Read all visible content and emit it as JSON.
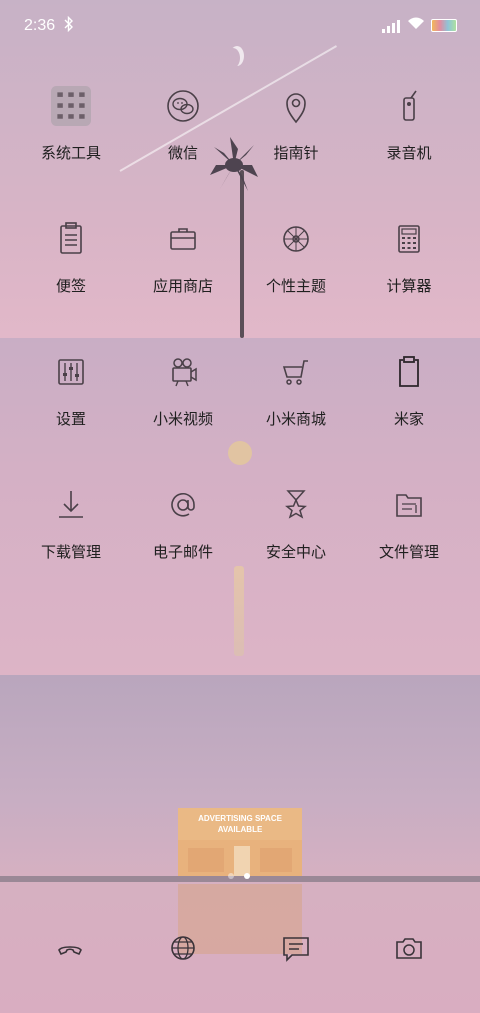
{
  "status": {
    "time": "2:36"
  },
  "apps": [
    {
      "label": "系统工具",
      "icon": "system-tools-folder-icon"
    },
    {
      "label": "微信",
      "icon": "wechat-icon"
    },
    {
      "label": "指南针",
      "icon": "compass-location-pin-icon"
    },
    {
      "label": "录音机",
      "icon": "recorder-icon"
    },
    {
      "label": "便签",
      "icon": "notes-clipboard-icon"
    },
    {
      "label": "应用商店",
      "icon": "app-store-bag-icon"
    },
    {
      "label": "个性主题",
      "icon": "themes-flower-icon"
    },
    {
      "label": "计算器",
      "icon": "calculator-icon"
    },
    {
      "label": "设置",
      "icon": "settings-sliders-icon"
    },
    {
      "label": "小米视频",
      "icon": "video-camera-icon"
    },
    {
      "label": "小米商城",
      "icon": "shopping-cart-icon"
    },
    {
      "label": "米家",
      "icon": "mijia-clipboard-icon"
    },
    {
      "label": "下载管理",
      "icon": "download-icon"
    },
    {
      "label": "电子邮件",
      "icon": "email-at-icon"
    },
    {
      "label": "安全中心",
      "icon": "security-star-icon"
    },
    {
      "label": "文件管理",
      "icon": "file-manager-folder-icon"
    }
  ],
  "wallpaper": {
    "sign_line1": "ADVERTISING SPACE",
    "sign_line2": "AVAILABLE"
  },
  "page_indicator": {
    "pages": 2,
    "current": 2
  },
  "dock": [
    "phone-icon",
    "browser-globe-icon",
    "messages-icon",
    "camera-icon"
  ],
  "colors": {
    "icon_stroke": "#4a4048",
    "label": "#202020",
    "status_text": "#ffffff"
  }
}
